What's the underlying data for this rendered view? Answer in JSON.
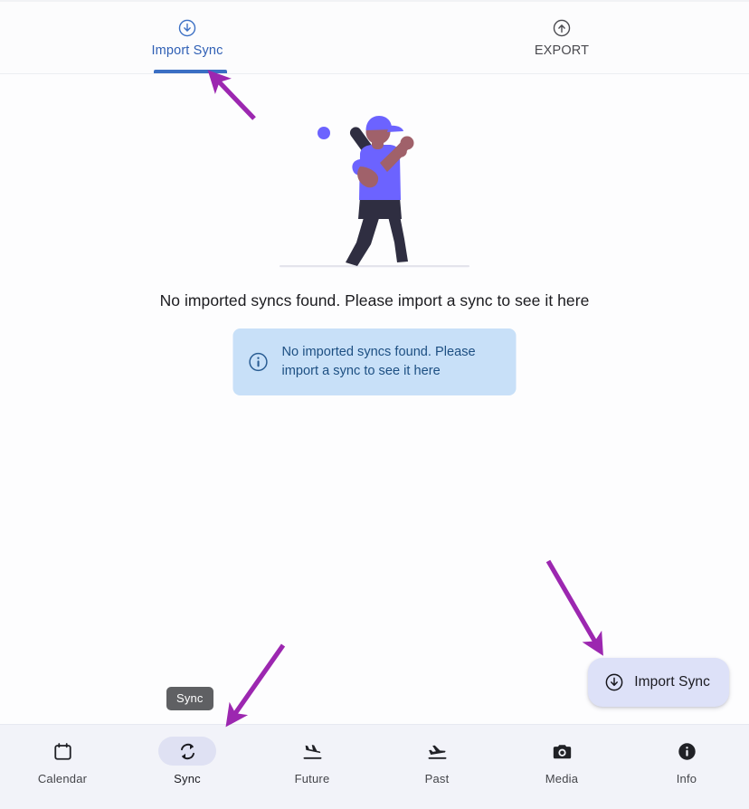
{
  "tabs": [
    {
      "label": "Import Sync",
      "icon": "arrow-circle-down-icon",
      "active": true
    },
    {
      "label": "EXPORT",
      "icon": "arrow-circle-up-icon",
      "active": false
    }
  ],
  "empty_state": {
    "illustration": "baseball-batter-illustration",
    "message": "No imported syncs found. Please import a sync to see it here"
  },
  "alert": {
    "icon": "info-circle-outline-icon",
    "text": "No imported syncs found. Please import a sync to see it here"
  },
  "fab": {
    "icon": "arrow-circle-down-icon",
    "label": "Import Sync"
  },
  "tooltip": {
    "text": "Sync"
  },
  "bottom_nav": [
    {
      "label": "Calendar",
      "icon": "calendar-icon",
      "active": false
    },
    {
      "label": "Sync",
      "icon": "sync-icon",
      "active": true
    },
    {
      "label": "Future",
      "icon": "flight-land-icon",
      "active": false
    },
    {
      "label": "Past",
      "icon": "flight-takeoff-icon",
      "active": false
    },
    {
      "label": "Media",
      "icon": "camera-icon",
      "active": false
    },
    {
      "label": "Info",
      "icon": "info-circle-filled-icon",
      "active": false
    }
  ],
  "annotations": [
    {
      "name": "arrow-to-import-sync-tab",
      "direction": "up-left"
    },
    {
      "name": "arrow-to-import-sync-fab",
      "direction": "down-right"
    },
    {
      "name": "arrow-to-sync-nav-item",
      "direction": "down-left"
    }
  ],
  "colors": {
    "tab_active": "#3b6fc4",
    "alert_bg": "#c8e0f8",
    "alert_text": "#1d4f82",
    "fab_bg": "#dde1f8",
    "nav_bg": "#f2f3f9",
    "nav_active_pill": "#dfe1f3",
    "annotation_arrow": "#9c27b0",
    "illustration_primary": "#6c63ff",
    "illustration_dark": "#2f2e41",
    "illustration_skin": "#a0616a",
    "tooltip_bg": "#5f6063"
  }
}
